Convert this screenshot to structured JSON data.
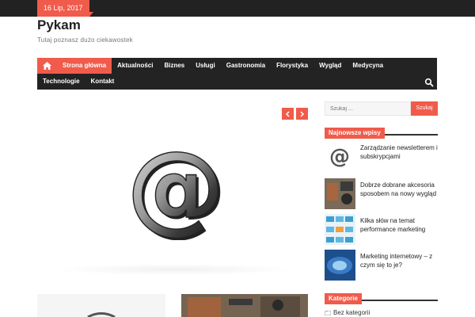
{
  "topbar": {
    "date": "16 Lip, 2017"
  },
  "site": {
    "title": "Pykam",
    "tagline": "Tutaj poznasz dużo ciekawostek"
  },
  "nav": {
    "row1": [
      "Strona główna",
      "Aktualności",
      "Biznes",
      "Usługi",
      "Gastronomia",
      "Florystyka",
      "Wygląd",
      "Medycyna"
    ],
    "row2": [
      "Technologie",
      "Kontakt"
    ]
  },
  "search": {
    "placeholder": "Szukaj ...",
    "button": "Szukaj"
  },
  "widgets": {
    "recent_title": "Najnowsze wpisy",
    "posts": [
      {
        "title": "Zarządzanie newsletterem i subskrypcjami"
      },
      {
        "title": "Dobrze dobrane akcesoria sposobem na nowy wygląd"
      },
      {
        "title": "Kilka słów na temat performance marketing"
      },
      {
        "title": "Marketing internetowy – z czym się to je?"
      }
    ],
    "categories_title": "Kategorie",
    "categories": [
      "Bez kategorii"
    ]
  },
  "colors": {
    "accent": "#f05b4b",
    "dark": "#232323"
  }
}
